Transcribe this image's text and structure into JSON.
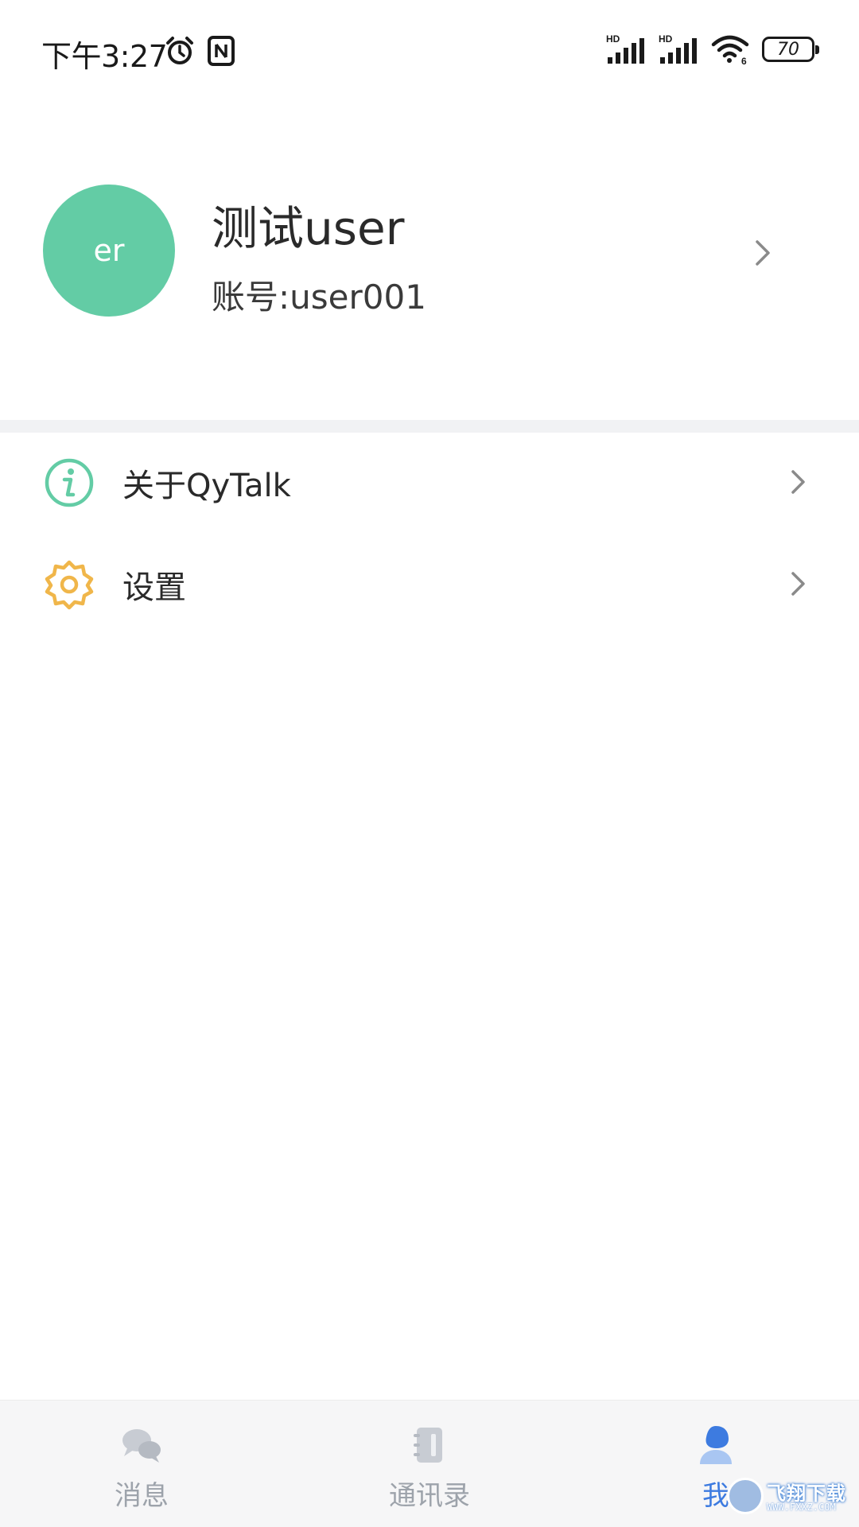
{
  "status_bar": {
    "time": "下午3:27",
    "icons": [
      "alarm-icon",
      "nfc-icon",
      "hd-signal-icon",
      "hd-signal-icon",
      "wifi-icon",
      "battery-icon"
    ],
    "signal_label_1": "HD",
    "signal_label_2": "HD",
    "wifi_badge": "6",
    "battery": "70"
  },
  "profile": {
    "avatar_text": "er",
    "avatar_color": "#63cca5",
    "name": "测试user",
    "account": "账号:user001"
  },
  "menu": {
    "items": [
      {
        "icon": "info-icon",
        "label": "关于QyTalk",
        "icon_color": "#63cca5"
      },
      {
        "icon": "gear-icon",
        "label": "设置",
        "icon_color": "#f0b64a"
      }
    ]
  },
  "bottom_nav": {
    "items": [
      {
        "icon": "chat-icon",
        "label": "消息",
        "active": false
      },
      {
        "icon": "contacts-icon",
        "label": "通讯录",
        "active": false
      },
      {
        "icon": "user-icon",
        "label": "我",
        "active": true
      }
    ],
    "active_color": "#3d7be0",
    "inactive_color": "#9da3ab"
  },
  "watermark": {
    "text": "飞翔下载",
    "url": "WWW.FXXZ.COM"
  }
}
